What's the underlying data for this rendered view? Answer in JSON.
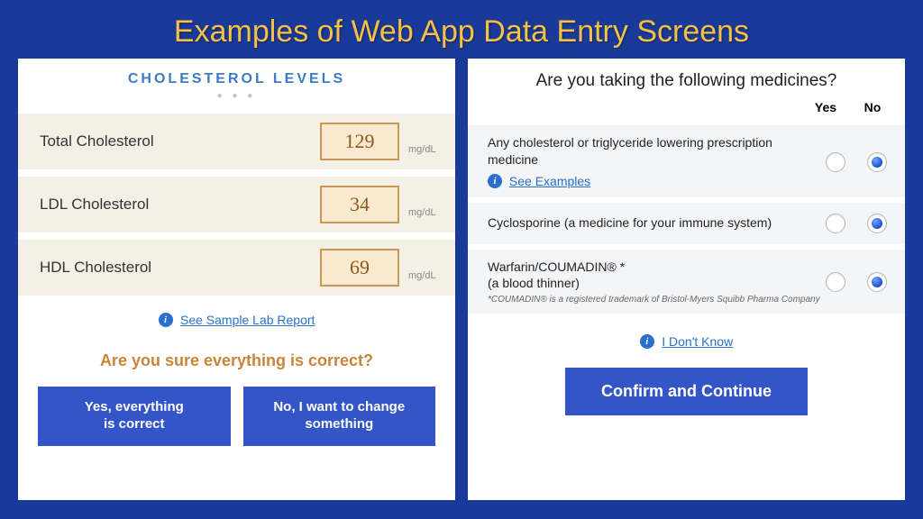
{
  "slide_title": "Examples of Web App Data Entry Screens",
  "left": {
    "header": "CHOLESTEROL LEVELS",
    "rows": [
      {
        "label": "Total Cholesterol",
        "value": "129",
        "unit": "mg/dL"
      },
      {
        "label": "LDL Cholesterol",
        "value": "34",
        "unit": "mg/dL"
      },
      {
        "label": "HDL Cholesterol",
        "value": "69",
        "unit": "mg/dL"
      }
    ],
    "sample_link": "See Sample Lab Report",
    "confirm_question": "Are you sure everything is correct?",
    "yes_btn": "Yes, everything\nis correct",
    "no_btn": "No, I want to change\nsomething"
  },
  "right": {
    "title": "Are you taking the following medicines?",
    "col_yes": "Yes",
    "col_no": "No",
    "rows": [
      {
        "text": "Any cholesterol or triglyceride lowering prescription medicine",
        "see_examples": "See Examples",
        "footnote": "",
        "selected": "no"
      },
      {
        "text": "Cyclosporine (a medicine for your immune system)",
        "see_examples": "",
        "footnote": "",
        "selected": "no"
      },
      {
        "text": "Warfarin/COUMADIN® *\n(a blood thinner)",
        "see_examples": "",
        "footnote": "*COUMADIN® is a registered trademark of Bristol-Myers Squibb Pharma Company",
        "selected": "no"
      }
    ],
    "dont_know": "I Don't Know",
    "confirm_btn": "Confirm and Continue"
  }
}
